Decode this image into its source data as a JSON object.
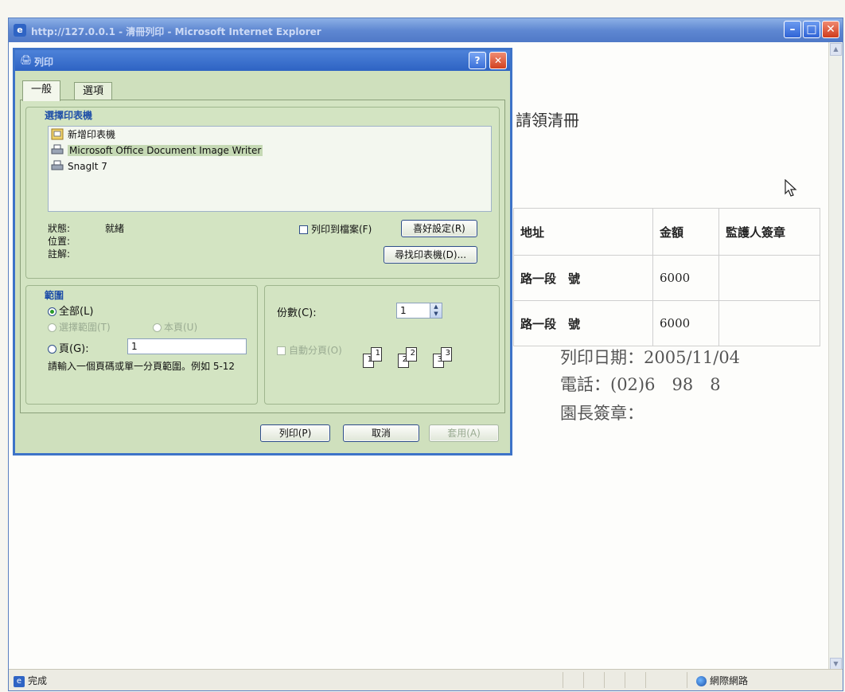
{
  "ie": {
    "title": "http://127.0.0.1 - 清冊列印 - Microsoft Internet Explorer",
    "status_left": "完成",
    "status_zone": "網際網路"
  },
  "document": {
    "title": "請領清冊",
    "table": {
      "headers": [
        "地址",
        "金額",
        "監護人簽章"
      ],
      "rows": [
        [
          "路一段　號",
          "6000",
          ""
        ],
        [
          "路一段　號",
          "6000",
          ""
        ]
      ]
    },
    "print_date": "列印日期：2005/11/04",
    "phone": "電話：(02)6　98　8",
    "director_signature": "園長簽章："
  },
  "print_dialog": {
    "title": "列印",
    "help_label": "?",
    "close_label": "✕",
    "tabs": [
      "一般",
      "選項"
    ],
    "printer_group_label": "選擇印表機",
    "printers": [
      {
        "name": "新增印表機",
        "icon": "add-printer-icon",
        "selected": false
      },
      {
        "name": "Microsoft Office Document Image Writer",
        "icon": "printer-icon",
        "selected": true
      },
      {
        "name": "SnagIt 7",
        "icon": "printer-icon",
        "selected": false
      }
    ],
    "status_label": "狀態:",
    "status_value": "就緒",
    "location_label": "位置:",
    "comment_label": "註解:",
    "print_to_file_label": "列印到檔案(F)",
    "print_to_file_checked": false,
    "preferences_button": "喜好設定(R)",
    "find_printer_button": "尋找印表機(D)...",
    "range_group_label": "範圍",
    "range_all": "全部(L)",
    "range_selection": "選擇範圍(T)",
    "range_current_page": "本頁(U)",
    "range_pages": "頁(G):",
    "pages_value": "1",
    "range_hint": "請輸入一個頁碼或單一分頁範圍。例如 5-12",
    "copies_label": "份數(C):",
    "copies_value": "1",
    "collate_label": "自動分頁(O)",
    "collate_checked": false,
    "print_button": "列印(P)",
    "cancel_button": "取消",
    "apply_button": "套用(A)"
  }
}
